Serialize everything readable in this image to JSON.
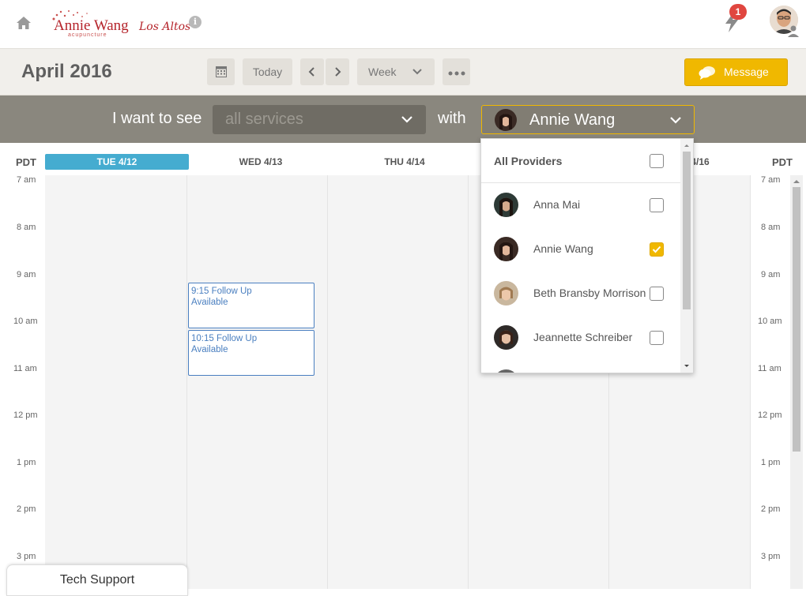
{
  "header": {
    "logo_name": "Annie Wang",
    "logo_script": "Los Altos",
    "logo_sub": "acupuncture",
    "notification_count": "1"
  },
  "toolbar": {
    "month_title": "April 2016",
    "today_label": "Today",
    "view_label": "Week",
    "message_label": "Message"
  },
  "filter": {
    "want_label": "I want to see",
    "services_placeholder": "all services",
    "with_label": "with",
    "provider_selected": "Annie Wang"
  },
  "calendar": {
    "tz_left": "PDT",
    "tz_right": "PDT",
    "days": [
      "TUE 4/12",
      "WED 4/13",
      "THU 4/14",
      "",
      "4/16"
    ],
    "times": [
      "7 am",
      "8 am",
      "9 am",
      "10 am",
      "11 am",
      "12 pm",
      "1 pm",
      "2 pm",
      "3 pm"
    ],
    "slots": [
      {
        "line1": "9:15 Follow Up",
        "line2": "Available"
      },
      {
        "line1": "10:15 Follow Up",
        "line2": "Available"
      }
    ]
  },
  "provider_dropdown": {
    "all_label": "All Providers",
    "items": [
      {
        "name": "Anna Mai",
        "checked": false
      },
      {
        "name": "Annie Wang",
        "checked": true
      },
      {
        "name": "Beth Bransby Morrison",
        "checked": false
      },
      {
        "name": "Jeannette Schreiber",
        "checked": false
      }
    ]
  },
  "footer": {
    "tech_support": "Tech Support"
  },
  "colors": {
    "accent": "#f0b800",
    "today": "#45acd0",
    "slot": "#4a7fc0",
    "filterbar": "#8a877e"
  }
}
